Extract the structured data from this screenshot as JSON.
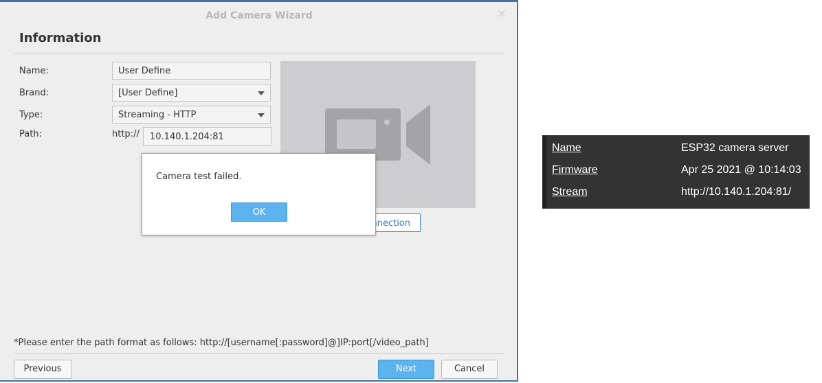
{
  "wizard": {
    "title": "Add Camera Wizard",
    "section_title": "Information",
    "fields": {
      "name_label": "Name:",
      "name_value": "User Define",
      "brand_label": "Brand:",
      "brand_value": "[User Define]",
      "type_label": "Type:",
      "type_value": "Streaming - HTTP",
      "path_label": "Path:",
      "path_prefix": "http://",
      "path_value": "10.140.1.204:81"
    },
    "test_connection_label": "nnection",
    "footnote": "*Please enter the path format as follows: http://[username[:password]@]IP:port[/video_path]",
    "buttons": {
      "previous": "Previous",
      "next": "Next",
      "cancel": "Cancel"
    }
  },
  "dialog": {
    "message": "Camera test failed.",
    "ok_label": "OK"
  },
  "info_panel": {
    "rows": [
      {
        "key": "Name",
        "value": "ESP32 camera server"
      },
      {
        "key": "Firmware",
        "value": "Apr 25 2021 @ 10:14:03"
      },
      {
        "key": "Stream",
        "value": "http://10.140.1.204:81/"
      }
    ]
  },
  "colors": {
    "accent_blue": "#5cb3ee",
    "panel_bg": "#333333",
    "dialog_bg": "#eeeeee"
  },
  "icons": [
    "close-icon",
    "dropdown-caret-icon",
    "video-camera-icon"
  ]
}
